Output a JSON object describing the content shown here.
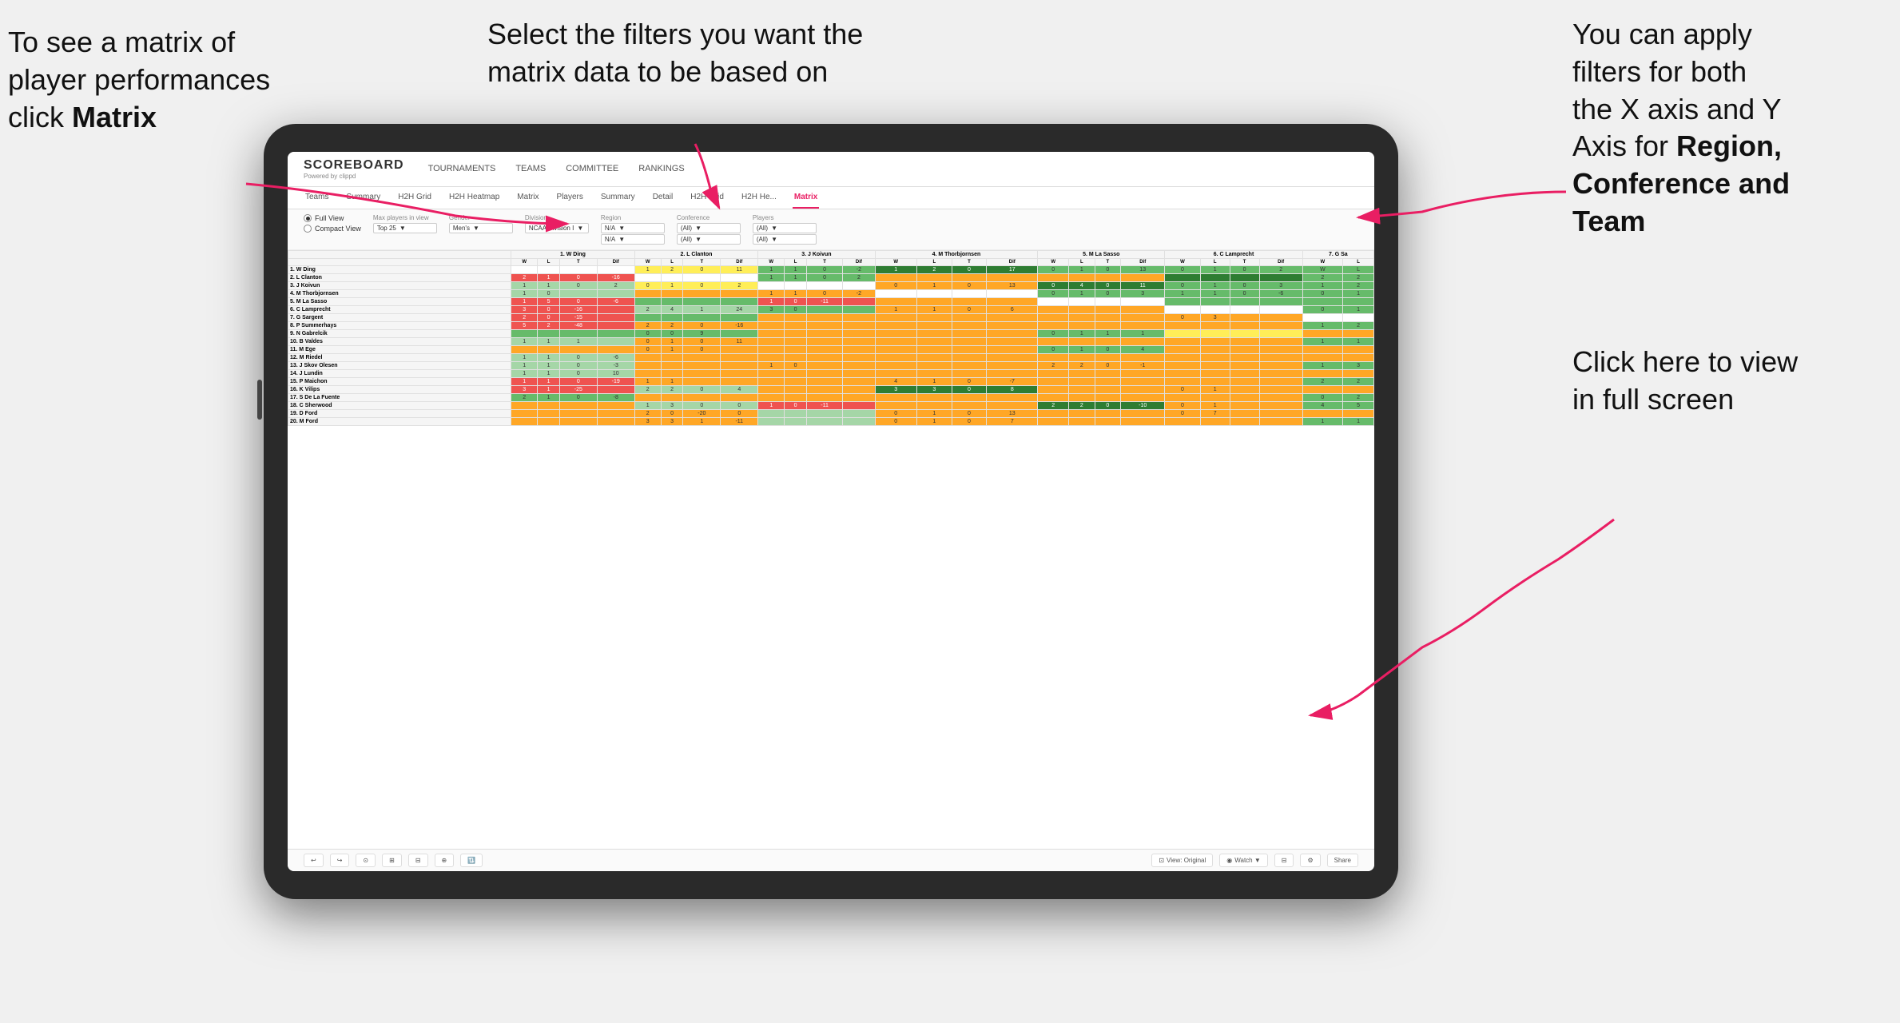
{
  "annotations": {
    "left": {
      "line1": "To see a matrix of",
      "line2": "player performances",
      "line3_normal": "click ",
      "line3_bold": "Matrix"
    },
    "center": {
      "text": "Select the filters you want the matrix data to be based on"
    },
    "right_top": {
      "line1": "You  can apply",
      "line2": "filters for both",
      "line3": "the X axis and Y",
      "line4_normal": "Axis for ",
      "line4_bold": "Region,",
      "line5_bold": "Conference and",
      "line6_bold": "Team"
    },
    "right_bottom": {
      "line1": "Click here to view",
      "line2": "in full screen"
    }
  },
  "app": {
    "logo": "SCOREBOARD",
    "logo_sub": "Powered by clippd",
    "nav": [
      "TOURNAMENTS",
      "TEAMS",
      "COMMITTEE",
      "RANKINGS"
    ],
    "sub_tabs": [
      "Teams",
      "Summary",
      "H2H Grid",
      "H2H Heatmap",
      "Matrix",
      "Players",
      "Summary",
      "Detail",
      "H2H Grid",
      "H2H He...",
      "Matrix"
    ],
    "active_tab": "Matrix"
  },
  "filters": {
    "view_options": [
      "Full View",
      "Compact View"
    ],
    "active_view": "Full View",
    "max_players_label": "Max players in view",
    "max_players_value": "Top 25",
    "gender_label": "Gender",
    "gender_value": "Men's",
    "division_label": "Division",
    "division_value": "NCAA Division I",
    "region_label": "Region",
    "region_value": "N/A",
    "region_value2": "N/A",
    "conference_label": "Conference",
    "conference_value": "(All)",
    "conference_value2": "(All)",
    "players_label": "Players",
    "players_value": "(All)",
    "players_value2": "(All)"
  },
  "matrix": {
    "col_headers": [
      "1. W Ding",
      "2. L Clanton",
      "3. J Koivun",
      "4. M Thorbjornsen",
      "5. M La Sasso",
      "6. C Lamprecht",
      "7. G Sa"
    ],
    "sub_headers": [
      "W",
      "L",
      "T",
      "Dif"
    ],
    "rows": [
      {
        "name": "1. W Ding",
        "cells": [
          {
            "type": "white",
            "values": []
          },
          {
            "type": "yellow",
            "values": [
              "1",
              "2",
              "0",
              "11"
            ]
          },
          {
            "type": "green",
            "values": [
              "1",
              "1",
              "0",
              "-2"
            ]
          },
          {
            "type": "green-dark",
            "values": [
              "1",
              "2",
              "0",
              "17"
            ]
          },
          {
            "type": "green",
            "values": [
              "0",
              "1",
              "0",
              "13"
            ]
          },
          {
            "type": "green",
            "values": [
              "0",
              "1",
              "0",
              "2"
            ]
          },
          {
            "type": "green",
            "values": [
              "W",
              "L"
            ]
          }
        ]
      },
      {
        "name": "2. L Clanton",
        "cells": [
          {
            "type": "red",
            "values": [
              "2",
              "1",
              "0",
              "-16"
            ]
          },
          {
            "type": "white",
            "values": []
          },
          {
            "type": "green",
            "values": [
              "1",
              "1",
              "0",
              "2"
            ]
          },
          {
            "type": "orange",
            "values": []
          },
          {
            "type": "orange",
            "values": []
          },
          {
            "type": "green-dark",
            "values": []
          },
          {
            "type": "green",
            "values": [
              "2",
              "2"
            ]
          }
        ]
      },
      {
        "name": "3. J Koivun",
        "cells": [
          {
            "type": "green-light",
            "values": [
              "1",
              "1",
              "0",
              "2"
            ]
          },
          {
            "type": "yellow",
            "values": [
              "0",
              "1",
              "0",
              "2"
            ]
          },
          {
            "type": "white",
            "values": []
          },
          {
            "type": "orange",
            "values": [
              "0",
              "1",
              "0",
              "13"
            ]
          },
          {
            "type": "green-dark",
            "values": [
              "0",
              "4",
              "0",
              "11"
            ]
          },
          {
            "type": "green",
            "values": [
              "0",
              "1",
              "0",
              "3"
            ]
          },
          {
            "type": "green",
            "values": [
              "1",
              "2"
            ]
          }
        ]
      },
      {
        "name": "4. M Thorbjornsen",
        "cells": [
          {
            "type": "green-light",
            "values": [
              "1",
              "0"
            ]
          },
          {
            "type": "orange",
            "values": []
          },
          {
            "type": "orange",
            "values": [
              "1",
              "1",
              "0",
              "-2"
            ]
          },
          {
            "type": "white",
            "values": []
          },
          {
            "type": "green",
            "values": [
              "0",
              "1",
              "0",
              "3"
            ]
          },
          {
            "type": "green",
            "values": [
              "1",
              "1",
              "0",
              "-6"
            ]
          },
          {
            "type": "green",
            "values": [
              "0",
              "1"
            ]
          }
        ]
      },
      {
        "name": "5. M La Sasso",
        "cells": [
          {
            "type": "red",
            "values": [
              "1",
              "5",
              "0",
              "-6"
            ]
          },
          {
            "type": "green",
            "values": []
          },
          {
            "type": "red",
            "values": [
              "1",
              "0",
              "-11"
            ]
          },
          {
            "type": "orange",
            "values": []
          },
          {
            "type": "white",
            "values": []
          },
          {
            "type": "green",
            "values": []
          },
          {
            "type": "green",
            "values": []
          }
        ]
      },
      {
        "name": "6. C Lamprecht",
        "cells": [
          {
            "type": "red",
            "values": [
              "3",
              "0",
              "-16"
            ]
          },
          {
            "type": "green-light",
            "values": [
              "2",
              "4",
              "1",
              "24"
            ]
          },
          {
            "type": "green",
            "values": [
              "3",
              "0"
            ]
          },
          {
            "type": "orange",
            "values": [
              "1",
              "1",
              "0",
              "6"
            ]
          },
          {
            "type": "orange",
            "values": []
          },
          {
            "type": "white",
            "values": []
          },
          {
            "type": "green",
            "values": [
              "0",
              "1"
            ]
          }
        ]
      },
      {
        "name": "7. G Sargent",
        "cells": [
          {
            "type": "red",
            "values": [
              "2",
              "0",
              "-15"
            ]
          },
          {
            "type": "green",
            "values": []
          },
          {
            "type": "orange",
            "values": []
          },
          {
            "type": "orange",
            "values": []
          },
          {
            "type": "orange",
            "values": []
          },
          {
            "type": "orange",
            "values": [
              "0",
              "3"
            ]
          },
          {
            "type": "white",
            "values": []
          }
        ]
      },
      {
        "name": "8. P Summerhays",
        "cells": [
          {
            "type": "red",
            "values": [
              "5",
              "2",
              "-48"
            ]
          },
          {
            "type": "orange",
            "values": [
              "2",
              "2",
              "0",
              "-16"
            ]
          },
          {
            "type": "orange",
            "values": []
          },
          {
            "type": "orange",
            "values": []
          },
          {
            "type": "orange",
            "values": []
          },
          {
            "type": "orange",
            "values": []
          },
          {
            "type": "green",
            "values": [
              "1",
              "2"
            ]
          }
        ]
      },
      {
        "name": "9. N Gabrelcik",
        "cells": [
          {
            "type": "green",
            "values": []
          },
          {
            "type": "green",
            "values": [
              "0",
              "0",
              "9"
            ]
          },
          {
            "type": "orange",
            "values": []
          },
          {
            "type": "orange",
            "values": []
          },
          {
            "type": "green",
            "values": [
              "0",
              "1",
              "1",
              "1"
            ]
          },
          {
            "type": "yellow",
            "values": []
          },
          {
            "type": "orange",
            "values": []
          }
        ]
      },
      {
        "name": "10. B Valdes",
        "cells": [
          {
            "type": "green-light",
            "values": [
              "1",
              "1",
              "1"
            ]
          },
          {
            "type": "orange",
            "values": [
              "0",
              "1",
              "0",
              "11"
            ]
          },
          {
            "type": "orange",
            "values": []
          },
          {
            "type": "orange",
            "values": []
          },
          {
            "type": "orange",
            "values": []
          },
          {
            "type": "orange",
            "values": []
          },
          {
            "type": "green",
            "values": [
              "1",
              "1",
              "1"
            ]
          }
        ]
      },
      {
        "name": "11. M Ege",
        "cells": [
          {
            "type": "orange",
            "values": []
          },
          {
            "type": "orange",
            "values": [
              "0",
              "1",
              "0"
            ]
          },
          {
            "type": "orange",
            "values": []
          },
          {
            "type": "orange",
            "values": []
          },
          {
            "type": "green",
            "values": [
              "0",
              "1",
              "0",
              "4"
            ]
          },
          {
            "type": "orange",
            "values": []
          },
          {
            "type": "orange",
            "values": []
          }
        ]
      },
      {
        "name": "12. M Riedel",
        "cells": [
          {
            "type": "green-light",
            "values": [
              "1",
              "1",
              "0",
              "-6"
            ]
          },
          {
            "type": "orange",
            "values": []
          },
          {
            "type": "orange",
            "values": []
          },
          {
            "type": "orange",
            "values": []
          },
          {
            "type": "orange",
            "values": []
          },
          {
            "type": "orange",
            "values": []
          },
          {
            "type": "orange",
            "values": []
          }
        ]
      },
      {
        "name": "13. J Skov Olesen",
        "cells": [
          {
            "type": "green-light",
            "values": [
              "1",
              "1",
              "0",
              "-3"
            ]
          },
          {
            "type": "orange",
            "values": []
          },
          {
            "type": "orange",
            "values": [
              "1",
              "0"
            ]
          },
          {
            "type": "orange",
            "values": []
          },
          {
            "type": "orange",
            "values": [
              "2",
              "2",
              "0",
              "-1"
            ]
          },
          {
            "type": "orange",
            "values": []
          },
          {
            "type": "green",
            "values": [
              "1",
              "3"
            ]
          }
        ]
      },
      {
        "name": "14. J Lundin",
        "cells": [
          {
            "type": "green-light",
            "values": [
              "1",
              "1",
              "0",
              "10"
            ]
          },
          {
            "type": "orange",
            "values": []
          },
          {
            "type": "orange",
            "values": []
          },
          {
            "type": "orange",
            "values": []
          },
          {
            "type": "orange",
            "values": []
          },
          {
            "type": "orange",
            "values": []
          },
          {
            "type": "orange",
            "values": []
          }
        ]
      },
      {
        "name": "15. P Maichon",
        "cells": [
          {
            "type": "red",
            "values": [
              "1",
              "1",
              "0",
              "-19"
            ]
          },
          {
            "type": "orange",
            "values": [
              "1",
              "1"
            ]
          },
          {
            "type": "orange",
            "values": []
          },
          {
            "type": "orange",
            "values": [
              "4",
              "1",
              "0",
              "-7"
            ]
          },
          {
            "type": "orange",
            "values": []
          },
          {
            "type": "orange",
            "values": []
          },
          {
            "type": "green",
            "values": [
              "2",
              "2"
            ]
          }
        ]
      },
      {
        "name": "16. K Vilips",
        "cells": [
          {
            "type": "red",
            "values": [
              "3",
              "1",
              "-25"
            ]
          },
          {
            "type": "green-light",
            "values": [
              "2",
              "2",
              "0",
              "4"
            ]
          },
          {
            "type": "orange",
            "values": []
          },
          {
            "type": "green-dark",
            "values": [
              "3",
              "3",
              "0",
              "8"
            ]
          },
          {
            "type": "orange",
            "values": []
          },
          {
            "type": "orange",
            "values": [
              "0",
              "1"
            ]
          },
          {
            "type": "orange",
            "values": []
          }
        ]
      },
      {
        "name": "17. S De La Fuente",
        "cells": [
          {
            "type": "green",
            "values": [
              "2",
              "1",
              "0",
              "-8"
            ]
          },
          {
            "type": "orange",
            "values": []
          },
          {
            "type": "orange",
            "values": []
          },
          {
            "type": "orange",
            "values": []
          },
          {
            "type": "orange",
            "values": []
          },
          {
            "type": "orange",
            "values": []
          },
          {
            "type": "green",
            "values": [
              "0",
              "2"
            ]
          }
        ]
      },
      {
        "name": "18. C Sherwood",
        "cells": [
          {
            "type": "orange",
            "values": []
          },
          {
            "type": "green-light",
            "values": [
              "1",
              "3",
              "0",
              "0"
            ]
          },
          {
            "type": "red",
            "values": [
              "1",
              "0",
              "-11"
            ]
          },
          {
            "type": "orange",
            "values": []
          },
          {
            "type": "green-dark",
            "values": [
              "2",
              "2",
              "0",
              "-10"
            ]
          },
          {
            "type": "orange",
            "values": [
              "0",
              "1"
            ]
          },
          {
            "type": "green",
            "values": [
              "4",
              "5"
            ]
          }
        ]
      },
      {
        "name": "19. D Ford",
        "cells": [
          {
            "type": "orange",
            "values": []
          },
          {
            "type": "orange",
            "values": [
              "2",
              "0",
              "-20",
              "0"
            ]
          },
          {
            "type": "green-light",
            "values": []
          },
          {
            "type": "orange",
            "values": [
              "0",
              "1",
              "0",
              "13"
            ]
          },
          {
            "type": "orange",
            "values": []
          },
          {
            "type": "orange",
            "values": [
              "0",
              "7"
            ]
          },
          {
            "type": "orange",
            "values": []
          }
        ]
      },
      {
        "name": "20. M Ford",
        "cells": [
          {
            "type": "orange",
            "values": []
          },
          {
            "type": "orange",
            "values": [
              "3",
              "3",
              "1",
              "-11"
            ]
          },
          {
            "type": "green-light",
            "values": []
          },
          {
            "type": "orange",
            "values": [
              "0",
              "1",
              "0",
              "7"
            ]
          },
          {
            "type": "orange",
            "values": []
          },
          {
            "type": "orange",
            "values": []
          },
          {
            "type": "green",
            "values": [
              "1",
              "1"
            ]
          }
        ]
      }
    ]
  },
  "toolbar": {
    "buttons": [
      "↩",
      "↪",
      "⊙",
      "⊞",
      "⊟",
      "⊕",
      "🔃"
    ],
    "view_label": "View: Original",
    "watch_label": "Watch ▼",
    "share_label": "Share"
  }
}
